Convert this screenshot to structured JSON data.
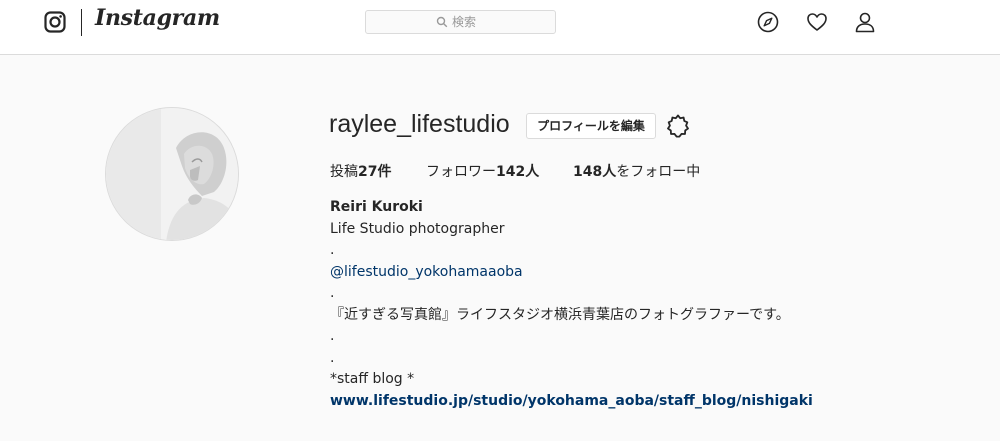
{
  "header": {
    "logo_text": "Instagram",
    "search_placeholder": "検索",
    "icons": [
      "instagram-glyph-icon",
      "search-icon",
      "compass-icon",
      "heart-icon",
      "user-icon"
    ]
  },
  "profile": {
    "username": "raylee_lifestudio",
    "edit_button": "プロフィールを編集",
    "stats": {
      "posts_label": "投稿",
      "posts_count": "27件",
      "followers_label": "フォロワー",
      "followers_count": "142人",
      "following_count": "148人",
      "following_label": "をフォロー中"
    },
    "bio": {
      "name": "Reiri Kuroki",
      "line1": "Life Studio photographer",
      "dot1": ".",
      "mention": "@lifestudio_yokohamaaoba",
      "dot2": ".",
      "description": "『近すぎる写真館』ライフスタジオ横浜青葉店のフォトグラファーです。",
      "dot3": ".",
      "dot4": ".",
      "blog_label": "*staff blog *",
      "link": "www.lifestudio.jp/studio/yokohama_aoba/staff_blog/nishigaki"
    }
  },
  "colors": {
    "link": "#003569",
    "border": "#dbdbdb",
    "background": "#fafafa",
    "text": "#262626"
  }
}
